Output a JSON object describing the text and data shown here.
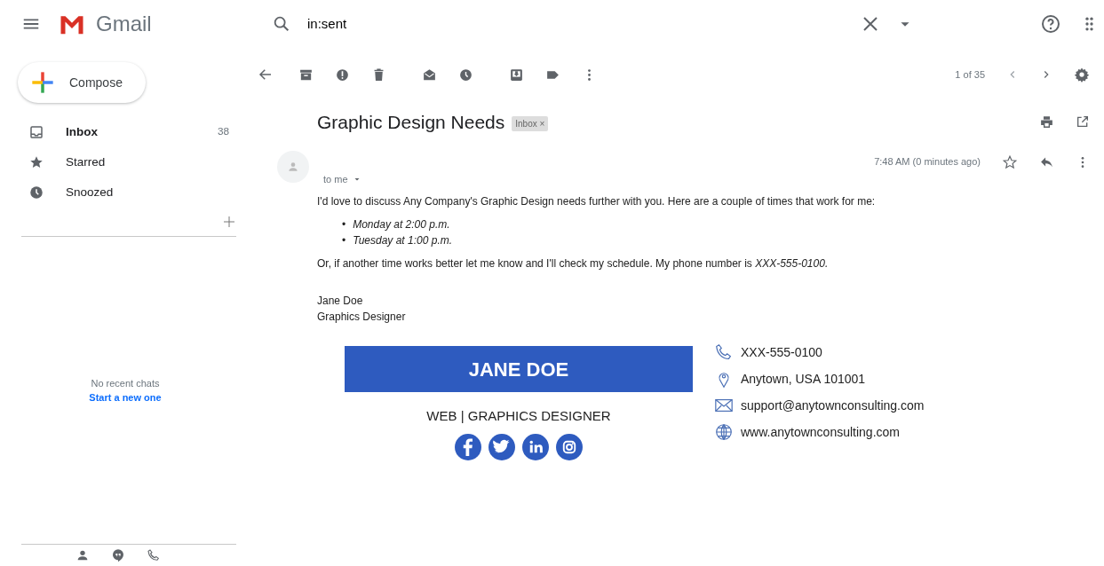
{
  "header": {
    "brand": "Gmail",
    "search_value": "in:sent"
  },
  "sidebar": {
    "compose": "Compose",
    "items": [
      {
        "kind": "inbox",
        "label": "Inbox",
        "count": "38",
        "selected": true
      },
      {
        "kind": "star",
        "label": "Starred",
        "selected": false
      },
      {
        "kind": "clock",
        "label": "Snoozed",
        "selected": false
      }
    ],
    "chats": {
      "empty": "No recent chats",
      "link": "Start a new one"
    }
  },
  "toolbar": {
    "counter": "1 of 35"
  },
  "message": {
    "subject": "Graphic Design Needs",
    "label": {
      "text": "Inbox",
      "close": "×"
    },
    "time": "7:48 AM (0 minutes ago)",
    "to": "to me",
    "intro": "I'd love to discuss Any Company's Graphic Design needs further with you. Here are a couple of times that work for me:",
    "times": [
      {
        "marker": "•",
        "text": "Monday at 2:00 p.m."
      },
      {
        "marker": "•",
        "text": "Tuesday at 1:00 p.m."
      }
    ],
    "closing": "Or, if another time works better let me know and I'll check my schedule. My phone number is *XXX-555-0100.*",
    "sender": [
      "Jane Doe",
      "Graphics Designer"
    ]
  },
  "signature": {
    "name": "JANE DOE",
    "title": "WEB | GRAPHICS DESIGNER",
    "social": [
      {
        "kind": "facebook"
      },
      {
        "kind": "twitter"
      },
      {
        "kind": "linkedin"
      },
      {
        "kind": "instagram"
      }
    ],
    "contacts": [
      {
        "kind": "phone",
        "text": "XXX-555-0100"
      },
      {
        "kind": "location",
        "text": "Anytown, USA 101001"
      },
      {
        "kind": "email",
        "text": "support@anytownconsulting.com"
      },
      {
        "kind": "web",
        "text": "www.anytownconsulting.com"
      }
    ]
  }
}
